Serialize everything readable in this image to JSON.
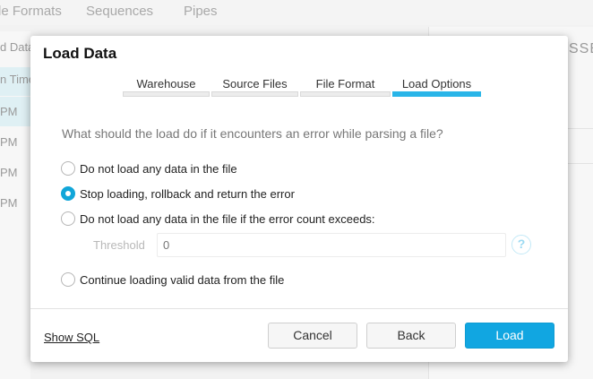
{
  "background": {
    "tabs": [
      {
        "label": "le Formats"
      },
      {
        "label": "Sequences"
      },
      {
        "label": "Pipes"
      }
    ],
    "left_rows": [
      "d Data",
      "n Time",
      "PM",
      "PM",
      "PM",
      "PM"
    ],
    "right_title": "SSE"
  },
  "modal": {
    "title": "Load Data",
    "steps": [
      {
        "label": "Warehouse",
        "active": false
      },
      {
        "label": "Source Files",
        "active": false
      },
      {
        "label": "File Format",
        "active": false
      },
      {
        "label": "Load Options",
        "active": true
      }
    ],
    "question": "What should the load do if it encounters an error while parsing a file?",
    "options": [
      {
        "label": "Do not load any data in the file",
        "checked": false
      },
      {
        "label": "Stop loading, rollback and return the error",
        "checked": true
      },
      {
        "label": "Do not load any data in the file if the error count exceeds:",
        "checked": false
      },
      {
        "label": "Continue loading valid data from the file",
        "checked": false
      }
    ],
    "threshold": {
      "label": "Threshold",
      "placeholder": "0",
      "help_icon": "question-circle-icon"
    },
    "footer": {
      "show_sql": "Show SQL",
      "cancel": "Cancel",
      "back": "Back",
      "load": "Load"
    }
  },
  "colors": {
    "accent": "#11a6e1",
    "active_step": "#29b5e8"
  }
}
